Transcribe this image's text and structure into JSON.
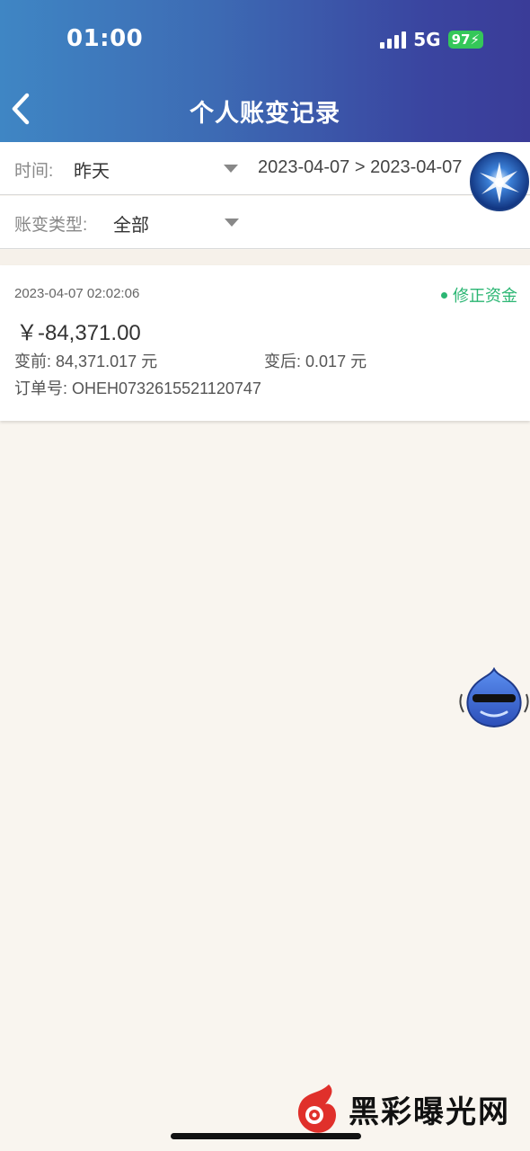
{
  "status_bar": {
    "time": "01:00",
    "network": "5G",
    "battery": "97"
  },
  "header": {
    "title": "个人账变记录"
  },
  "filters": {
    "time_label": "时间:",
    "time_value": "昨天",
    "date_range": "2023-04-07 > 2023-04-07",
    "type_label": "账变类型:",
    "type_value": "全部"
  },
  "records": [
    {
      "datetime": "2023-04-07 02:02:06",
      "status": "修正资金",
      "amount": "￥-84,371.00",
      "before_label": "变前:",
      "before_value": "84,371.017 元",
      "after_label": "变后:",
      "after_value": "0.017 元",
      "order_label": "订单号:",
      "order_value": "OHEH0732615521120747"
    }
  ],
  "watermark": {
    "text": "黑彩曝光网"
  },
  "colors": {
    "header_start": "#3f86c4",
    "header_end": "#3a3c98",
    "status_green": "#2bb673",
    "page_bg": "#f9f5ef"
  },
  "icons": [
    "back-chevron-icon",
    "signal-icon",
    "battery-icon",
    "dropdown-caret-icon",
    "floating-orb-icon",
    "floating-mascot-icon",
    "watermark-logo-icon"
  ]
}
